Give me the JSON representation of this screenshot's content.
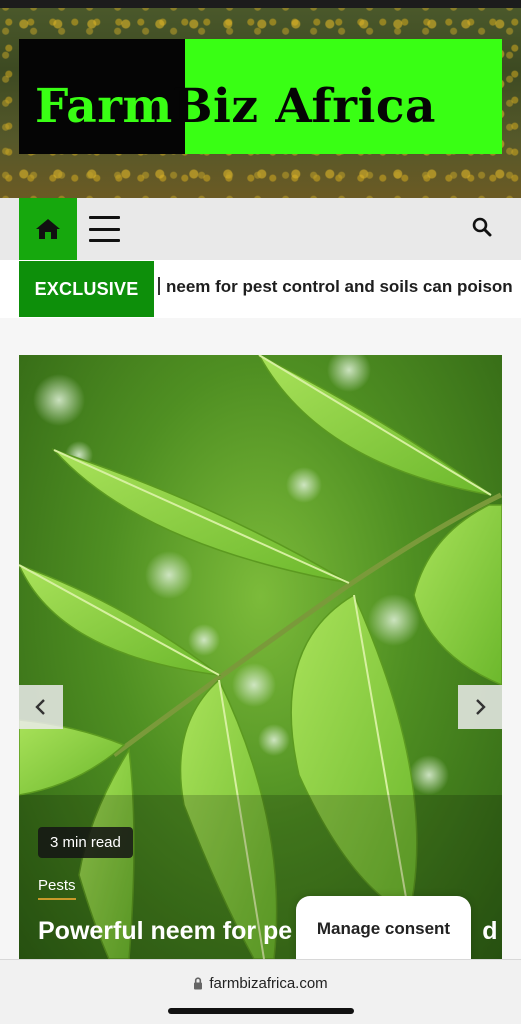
{
  "header": {
    "logo_part1": "Farm",
    "logo_part2": "Biz Africa"
  },
  "navbar": {
    "home_icon": "home-icon",
    "menu_icon": "hamburger-menu-icon",
    "search_icon": "search-icon"
  },
  "ticker": {
    "label": "EXCLUSIVE",
    "headline": "neem for pest control and soils can poison"
  },
  "hero": {
    "read_time": "3 min read",
    "category": "Pests",
    "title": "Powerful neem for pe",
    "title_tail": "d",
    "prev_icon": "chevron-left-icon",
    "next_icon": "chevron-right-icon"
  },
  "consent": {
    "label": "Manage consent"
  },
  "browser": {
    "url": "farmbizafrica.com",
    "lock_icon": "lock-icon"
  },
  "colors": {
    "brand_green": "#39ff14",
    "nav_green": "#16a80d",
    "ticker_green": "#0d8f0a"
  }
}
